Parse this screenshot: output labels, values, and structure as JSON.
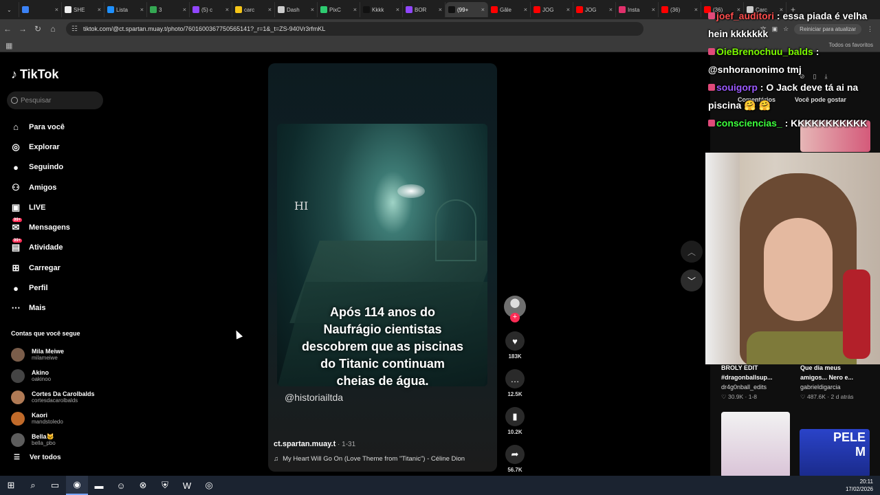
{
  "browser": {
    "tabs": [
      {
        "label": "",
        "color": "#3b82f6"
      },
      {
        "label": "SHE",
        "color": "#eeeeee"
      },
      {
        "label": "Lista",
        "color": "#1e90ff"
      },
      {
        "label": "3",
        "color": "#34a853"
      },
      {
        "label": "(5) c",
        "color": "#9146ff"
      },
      {
        "label": "carc",
        "color": "#f5c518"
      },
      {
        "label": "Dash",
        "color": "#cccccc"
      },
      {
        "label": "PixC",
        "color": "#2ecc71"
      },
      {
        "label": "Kkkk",
        "color": "#111111"
      },
      {
        "label": "BOR",
        "color": "#9146ff"
      },
      {
        "label": "(99+",
        "color": "#111111",
        "active": true
      },
      {
        "label": "Gâle",
        "color": "#ff0000"
      },
      {
        "label": "JOG",
        "color": "#ff0000"
      },
      {
        "label": "JOG",
        "color": "#ff0000"
      },
      {
        "label": "Insta",
        "color": "#e1306c"
      },
      {
        "label": "(36)",
        "color": "#ff0000"
      },
      {
        "label": "(36)",
        "color": "#ff0000"
      },
      {
        "label": "Carc",
        "color": "#cccccc"
      }
    ],
    "url": "tiktok.com/@ct.spartan.muay.t/photo/7601600367750565141?_r=1&_t=ZS-940Vr3rfmKL",
    "reload_label": "Reiniciar para atualizar",
    "all_favorites": "Todos os favoritos"
  },
  "sidebar": {
    "brand": "TikTok",
    "search_placeholder": "Pesquisar",
    "nav": [
      {
        "label": "Para você",
        "icon": "home-icon"
      },
      {
        "label": "Explorar",
        "icon": "compass-icon"
      },
      {
        "label": "Seguindo",
        "icon": "avatar-icon"
      },
      {
        "label": "Amigos",
        "icon": "friends-icon"
      },
      {
        "label": "LIVE",
        "icon": "live-icon"
      },
      {
        "label": "Mensagens",
        "icon": "messages-icon",
        "badge": "99+"
      },
      {
        "label": "Atividade",
        "icon": "activity-icon",
        "badge": "99+"
      },
      {
        "label": "Carregar",
        "icon": "upload-icon"
      },
      {
        "label": "Perfil",
        "icon": "profile-icon"
      },
      {
        "label": "Mais",
        "icon": "more-icon"
      }
    ],
    "following_title": "Contas que você segue",
    "following": [
      {
        "name": "Mila Meiwe",
        "user": "milameiwe",
        "color": "#7a5d4a"
      },
      {
        "name": "Akino",
        "user": "oakinoo",
        "color": "#444444"
      },
      {
        "name": "Cortes Da Carolbalds",
        "user": "cortesdacarolbalds",
        "color": "#b07a55"
      },
      {
        "name": "Kaori",
        "user": "mandstoledo",
        "color": "#c06a2a"
      },
      {
        "name": "Bella🐱",
        "user": "bella_pbo",
        "color": "#5d5d5d"
      }
    ],
    "see_all": "Ver todos"
  },
  "video": {
    "watermark_corner": "HI",
    "caption": "Após 114 anos do\nNaufrágio cientistas\ndescobrem que as piscinas\ndo Titanic continuam\ncheias de água.",
    "credit": "@historiailtda",
    "author": "ct.spartan.muay.t",
    "date": " · 1-31",
    "music": "My Heart Will Go On (Love Theme from \"Titanic\") - Céline Dion"
  },
  "actions": {
    "likes": "183K",
    "comments": "12.5K",
    "saves": "10.2K",
    "shares": "56.7K"
  },
  "right_panel": {
    "tab_comments": "Comentários",
    "tab_suggest": "Você pode gostar",
    "cards": [
      {
        "title": "BROLY EDIT\n#dragonballsup...",
        "user": "dr4g0nball_edits",
        "meta": "♡ 30.9K · 1-8"
      },
      {
        "title": "Que dia meus\namigos... Nero e...",
        "user": "gabrieldigarcia",
        "meta": "♡ 487.6K · 2 d atrás"
      }
    ],
    "thumb3_text": "PELE\nM"
  },
  "chat": [
    {
      "user": "joef_auditori",
      "text": ": essa piada é velha hein kkkkkkk",
      "cls": "u1"
    },
    {
      "user": "OieBrenochuu_balds",
      "text": ": @snhoranonimo tmj",
      "cls": "u2"
    },
    {
      "user": "souigorp",
      "text": ": O Jack deve tá ai na piscina 🤗 🤗",
      "cls": "u3"
    },
    {
      "user": "consciencias_",
      "text": ": KKKKKKKKKKK",
      "cls": "u4"
    }
  ],
  "taskbar": {
    "time": "20:11",
    "date": "17/02/2026"
  }
}
